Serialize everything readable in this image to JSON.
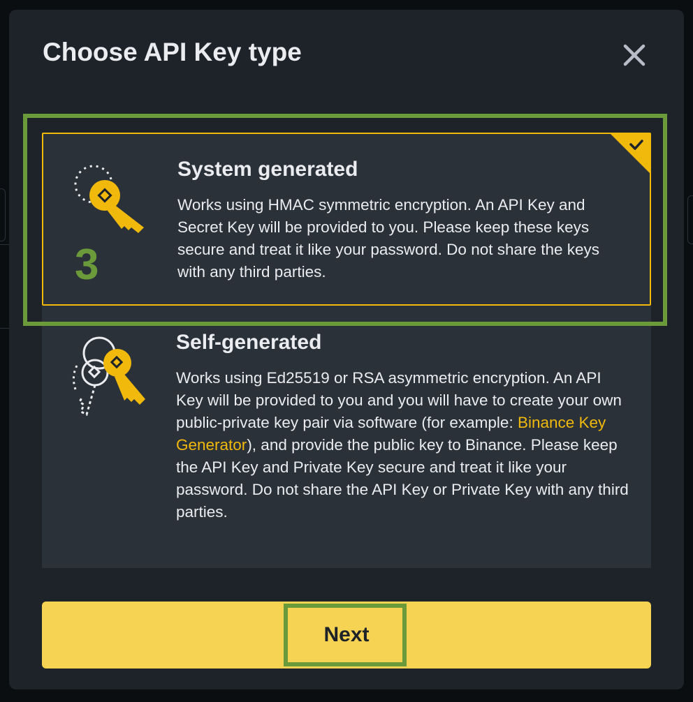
{
  "dialog": {
    "title": "Choose API Key type",
    "close_icon": "close-icon"
  },
  "options": [
    {
      "title": "System generated",
      "description": "Works using HMAC symmetric encryption. An API Key and Secret Key will be provided to you. Please keep these keys secure and treat it like your password. Do not share the keys with any third parties.",
      "icon": "key-icon",
      "selected": true,
      "step_label": "3"
    },
    {
      "title": "Self-generated",
      "description_before_link": "Works using Ed25519 or RSA asymmetric encryption. An API Key will be provided to you and you will have to create your own public-private key pair via software (for example: ",
      "link_text": "Binance Key Generator",
      "description_after_link": "), and provide the public key to Binance. Please keep the API Key and Private Key secure and treat it like your password. Do not share the API Key or Private Key with any third parties.",
      "icon": "key-pair-icon",
      "selected": false
    }
  ],
  "next_button": {
    "label": "Next"
  },
  "colors": {
    "accent": "#f0b90b",
    "button": "#f6d352",
    "highlight": "#6a9a3a",
    "modal_bg": "#1e2329",
    "card_bg": "#2b3139"
  }
}
